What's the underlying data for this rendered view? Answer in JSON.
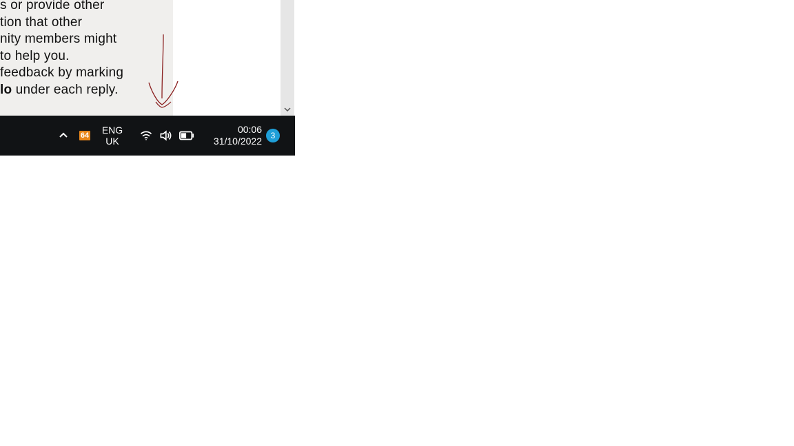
{
  "panel": {
    "line1": "s or provide other",
    "line2": "tion that other",
    "line3": "nity members might",
    "line4": "to help you.",
    "line5a": " feedback by marking",
    "line6a": "lo",
    "line6b": " under each reply."
  },
  "taskbar": {
    "temp_badge": "64",
    "lang_top": "ENG",
    "lang_bottom": "UK",
    "time": "00:06",
    "date": "31/10/2022",
    "notif_count": "3"
  }
}
